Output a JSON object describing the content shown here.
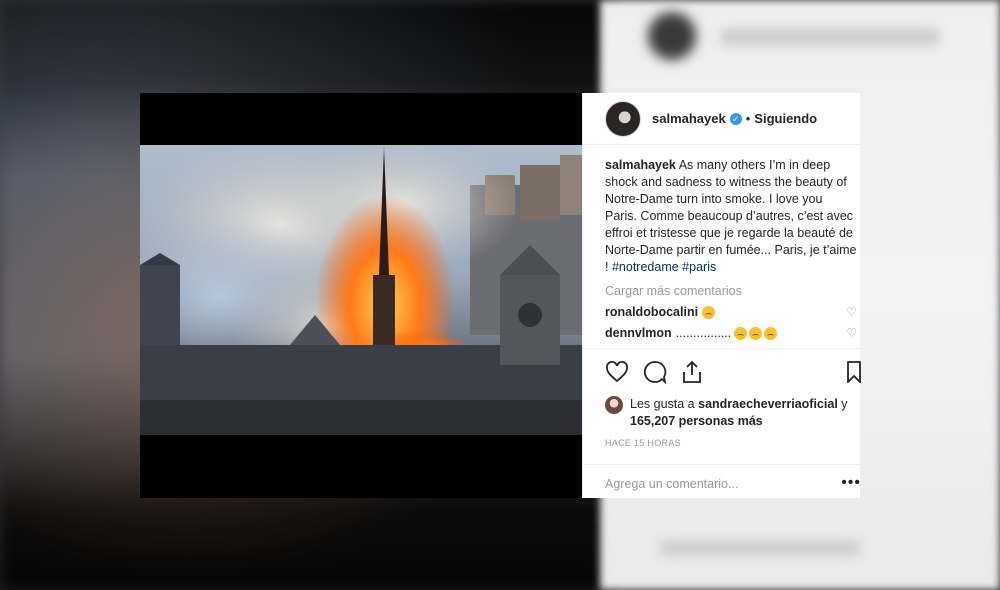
{
  "post": {
    "username": "salmahayek",
    "verified_mark": "✓",
    "separator": "•",
    "follow_status": "Siguiendo",
    "caption": {
      "author": "salmahayek",
      "text": "As many others I’m in deep shock and sadness to witness the beauty of Notre-Dame turn into smoke. I love you Paris. Comme beaucoup d’autres, c’est avec effroi et tristesse que je regarde la beauté de Norte-Dame partir en fumée... Paris, je t’aime !",
      "hashtags": [
        "#notredame",
        "#paris"
      ]
    },
    "load_more": "Cargar más comentarios",
    "comments": [
      {
        "author": "ronaldobocalini",
        "text": "",
        "emoji_count": 1
      },
      {
        "author": "dennvlmon",
        "text": "................",
        "emoji_count": 3
      }
    ],
    "likes": {
      "prefix": "Les gusta a",
      "first_user": "sandraecheverriaoficial",
      "joiner": "y",
      "count": "165,207 personas más"
    },
    "time": "HACE 15 HORAS",
    "add_comment_placeholder": "Agrega un comentario...",
    "more_options": "•••"
  },
  "icons": [
    "heart-icon",
    "comment-icon",
    "share-icon",
    "bookmark-icon",
    "verified-icon",
    "more-options-icon"
  ]
}
